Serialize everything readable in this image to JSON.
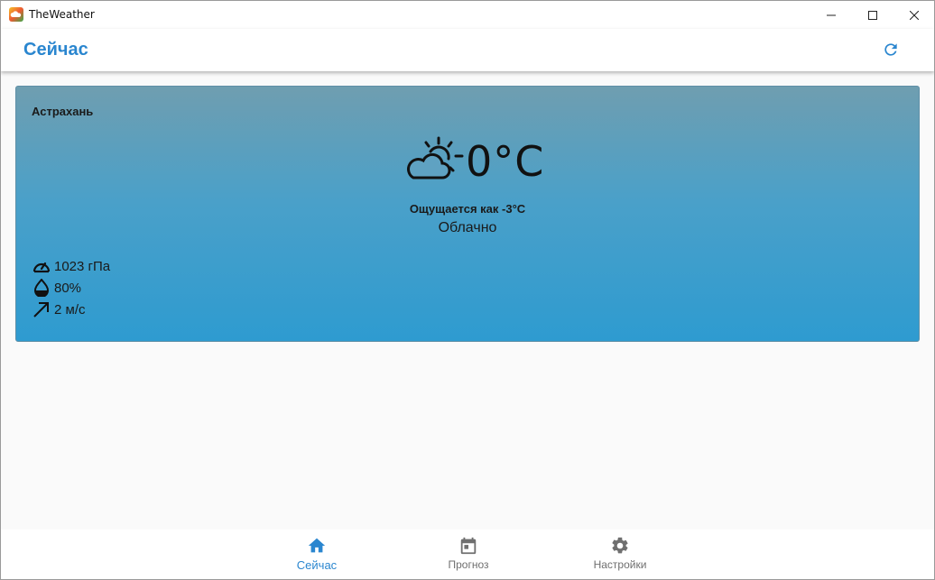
{
  "window": {
    "title": "TheWeather"
  },
  "appbar": {
    "title": "Сейчас"
  },
  "weather": {
    "city": "Астрахань",
    "temperature": "0°C",
    "feels_like": "Ощущается как -3°C",
    "condition": "Облачно",
    "pressure": "1023 гПа",
    "humidity": "80%",
    "wind": "2 м/с",
    "icon": "partly-cloudy-icon"
  },
  "nav": {
    "items": [
      {
        "label": "Сейчас",
        "icon": "home-icon",
        "active": true
      },
      {
        "label": "Прогноз",
        "icon": "calendar-icon",
        "active": false
      },
      {
        "label": "Настройки",
        "icon": "gear-icon",
        "active": false
      }
    ]
  },
  "colors": {
    "accent": "#2a86cf",
    "card_top": "#6f9eb0",
    "card_bottom": "#2e9bd0",
    "inactive": "#6f6f6f"
  }
}
